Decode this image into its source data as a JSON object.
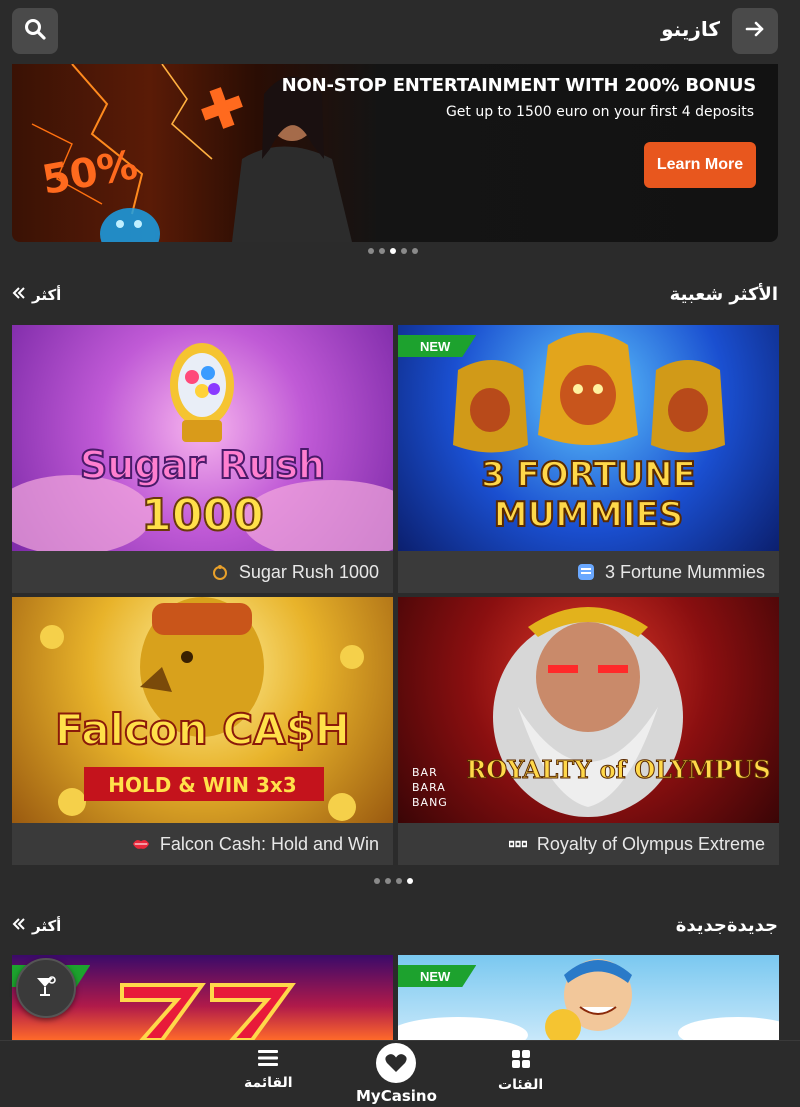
{
  "header": {
    "title": "كازينو",
    "search_icon": "search-icon",
    "back_icon": "arrow-right-icon"
  },
  "banner": {
    "title": "NON-STOP ENTERTAINMENT WITH 200% BONUS",
    "subtitle": "Get up to 1500 euro on your first 4 deposits",
    "cta_label": "Learn More",
    "art_text_percent": "50%",
    "accent_color": "#e8571e",
    "slide_count": 5,
    "active_slide_index": 2
  },
  "sections": [
    {
      "title": "الأكثر شعبية",
      "more_label": "أكثر",
      "page_count": 4,
      "active_page_index": 3,
      "games": [
        {
          "name": "Sugar Rush 1000",
          "art_line1": "Sugar Rush",
          "art_line2": "1000",
          "provider_icon": "pragmatic-icon",
          "is_new": false
        },
        {
          "name": "3 Fortune Mummies",
          "art_line1": "3 FORTUNE",
          "art_line2": "MUMMIES",
          "provider_icon": "booongo-icon",
          "is_new": true,
          "new_label": "NEW"
        },
        {
          "name": "Falcon Cash: Hold and Win",
          "art_line1": "Falcon CA$H",
          "art_line2": "HOLD & WIN 3x3",
          "provider_icon": "lips-icon",
          "is_new": false
        },
        {
          "name": "Royalty of Olympus Extreme",
          "art_line1": "ROYALTY of OLYMPUS",
          "art_line2": "BAR BARA BANG",
          "provider_icon": "barbarabang-icon",
          "is_new": false
        }
      ]
    },
    {
      "title": "جديدةجديدة",
      "more_label": "أكثر",
      "games": [
        {
          "name": "",
          "is_new": true,
          "new_label": "NEW"
        },
        {
          "name": "",
          "is_new": true,
          "new_label": "NEW"
        }
      ]
    }
  ],
  "bottom_nav": {
    "items": [
      {
        "label": "القائمة",
        "icon": "menu-icon"
      },
      {
        "label": "MyCasino",
        "icon": "heart-icon"
      },
      {
        "label": "الفئات",
        "icon": "grid-icon"
      }
    ],
    "fab_icon": "cocktail-icon"
  }
}
